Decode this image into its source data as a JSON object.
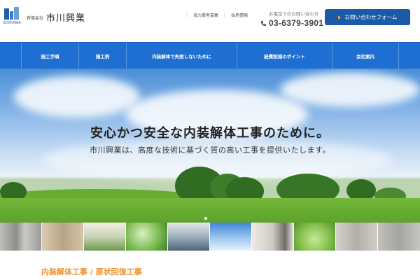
{
  "header": {
    "company_type": "有限会社",
    "company_name": "市川興業",
    "logo_caption": "ICHIKAWA",
    "top_links": [
      "協力業者募集",
      "採用情報"
    ],
    "phone_label": "お電話でのお問い合わせ",
    "phone_number": "03-6379-3901",
    "contact_button": "お問い合わせフォーム",
    "accent_color": "#1a5aa6",
    "arrow_color": "#f2a33a"
  },
  "nav": {
    "color": "#1e6fd1",
    "items": [
      {
        "label": "施工手順"
      },
      {
        "label": "施工例"
      },
      {
        "label": "内装解体で失敗しないために"
      },
      {
        "label": "経費削減のポイント"
      },
      {
        "label": "会社案内"
      }
    ]
  },
  "hero": {
    "title": "安心かつ安全な内装解体工事のために。",
    "subtitle": "市川興業は、高度な技術に基づく質の高い工事を提供いたします。",
    "slide_count": 1,
    "active_slide": 1
  },
  "thumbnails": [
    {
      "name": "concrete-wall",
      "color": "#a9a9a6"
    },
    {
      "name": "wood-panel",
      "color": "#c9b89a"
    },
    {
      "name": "grass-field",
      "color": "#8fa86a"
    },
    {
      "name": "green-leaves",
      "color": "#6fae4c"
    },
    {
      "name": "worker-demolition",
      "color": "#6d8a9a"
    },
    {
      "name": "blue-sky",
      "color": "#6ea9e0"
    },
    {
      "name": "worker-interior",
      "color": "#d8d4cf"
    },
    {
      "name": "fresh-leaves",
      "color": "#8bc34a"
    },
    {
      "name": "plaster-wall",
      "color": "#bfbcb6"
    },
    {
      "name": "concrete-surface",
      "color": "#b4b2ad"
    }
  ],
  "section": {
    "title": "内装解体工事 / 原状回復工事",
    "title_color": "#f0922d"
  }
}
